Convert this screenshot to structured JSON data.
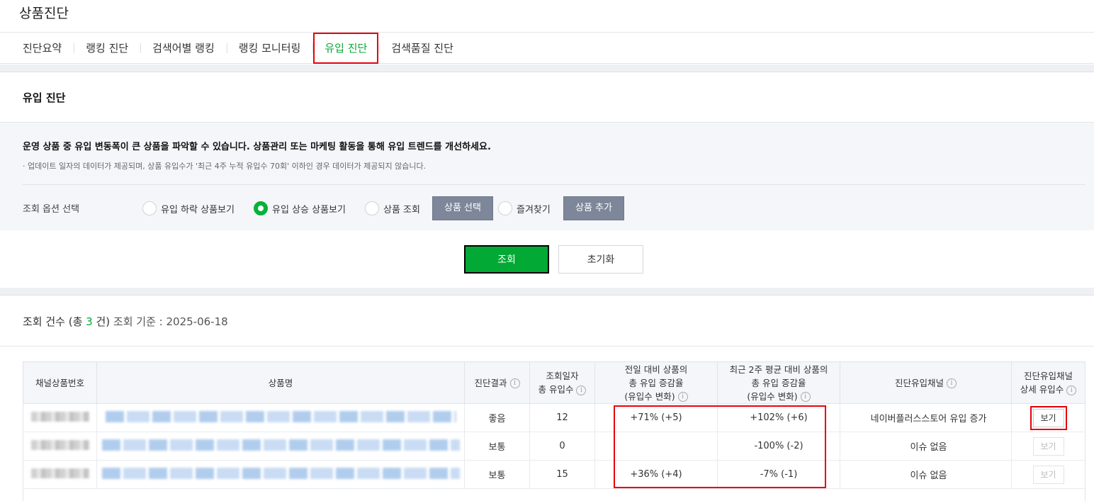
{
  "page": {
    "title": "상품진단"
  },
  "tabs": [
    {
      "label": "진단요약"
    },
    {
      "label": "랭킹 진단"
    },
    {
      "label": "검색어별 랭킹"
    },
    {
      "label": "랭킹 모니터링"
    },
    {
      "label": "유입 진단",
      "active": true
    },
    {
      "label": "검색품질 진단"
    }
  ],
  "section": {
    "title": "유입 진단",
    "description": "운영 상품 중 유입 변동폭이 큰 상품을 파악할 수 있습니다. 상품관리 또는 마케팅 활동을 통해 유입 트렌드를 개선하세요.",
    "note": "· 업데이트 일자의 데이터가 제공되며, 상품 유입수가 '최근 4주 누적 유입수 70회' 이하인 경우 데이터가 제공되지 않습니다."
  },
  "options": {
    "label": "조회 옵션 선택",
    "radio_decline": "유입 하락 상품보기",
    "radio_rise": "유입 상승 상품보기",
    "radio_product": "상품 조회",
    "product_select_button": "상품 선택",
    "radio_favorites": "즐겨찾기",
    "product_add_button": "상품 추가",
    "selected": "유입 상승 상품보기"
  },
  "actions": {
    "search": "조회",
    "reset": "초기화"
  },
  "summary": {
    "prefix": "조회 건수 (총 ",
    "count": "3",
    "suffix": " 건)",
    "basis": "조회 기준 : 2025-06-18"
  },
  "table": {
    "headers": {
      "id": "채널상품번호",
      "name": "상품명",
      "result": "진단결과",
      "visits_1": "조회일자",
      "visits_2": "총 유입수",
      "daily_1": "전일 대비 상품의",
      "daily_2": "총 유입 증감율",
      "daily_3": "(유입수 변화)",
      "twoweek_1": "최근 2주 평균 대비 상품의",
      "twoweek_2": "총 유입 증감율",
      "twoweek_3": "(유입수 변화)",
      "channel": "진단유입채널",
      "detail_1": "진단유입채널",
      "detail_2": "상세 유입수"
    },
    "info_glyph": "i",
    "rows": [
      {
        "result": "좋음",
        "visits": "12",
        "daily": "+71% (+5)",
        "twoweek": "+102% (+6)",
        "channel": "네이버플러스스토어 유입 증가",
        "view": "보기"
      },
      {
        "result": "보통",
        "visits": "0",
        "daily": "",
        "twoweek": "-100% (-2)",
        "channel": "이슈 없음",
        "view": "보기"
      },
      {
        "result": "보통",
        "visits": "15",
        "daily": "+36% (+4)",
        "twoweek": "-7% (-1)",
        "channel": "이슈 없음",
        "view": "보기"
      }
    ]
  },
  "colors": {
    "accent": "#03a935",
    "positive": "#e63b3b",
    "negative": "#1a73c9",
    "annotation": "#e8000b"
  }
}
